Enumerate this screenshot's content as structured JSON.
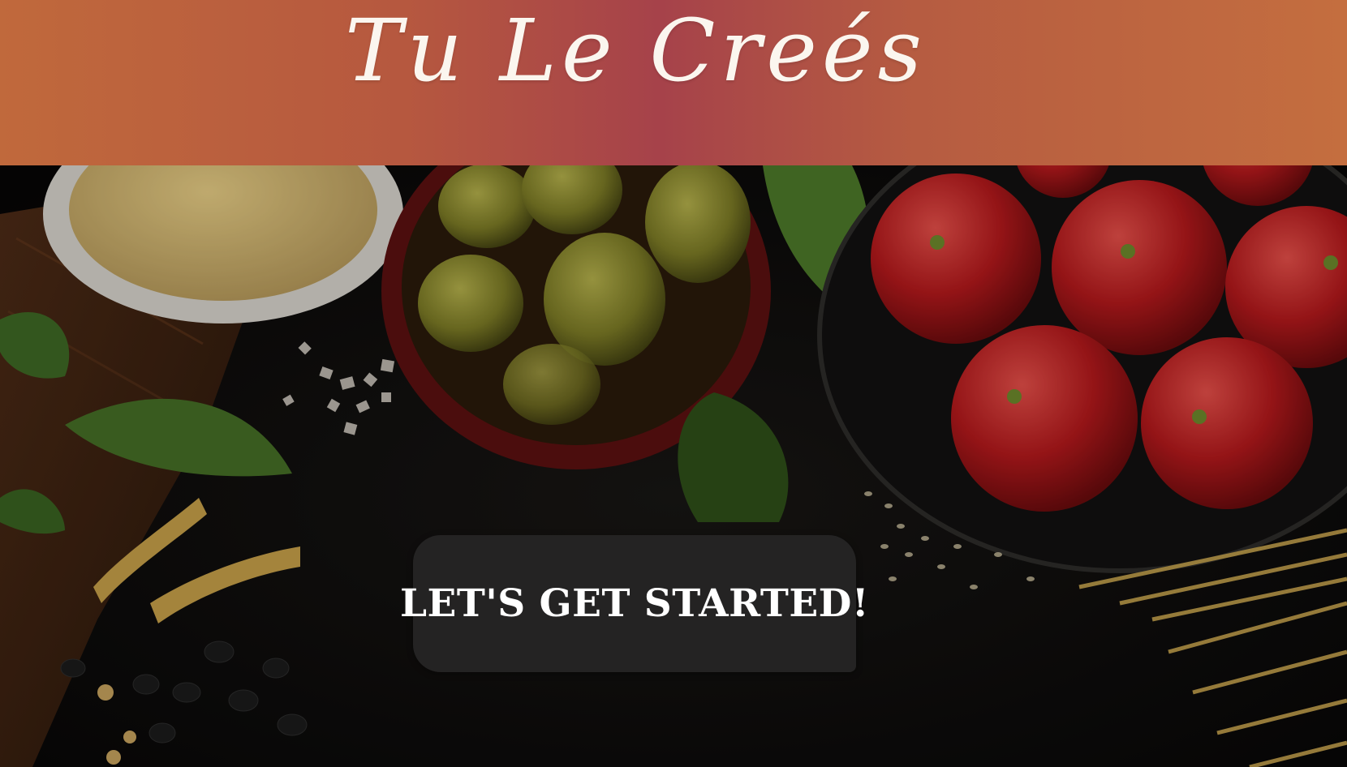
{
  "header": {
    "brand_title": "Tu Le Creés",
    "background_color": "#b0504a"
  },
  "hero": {
    "image_icon": "food-ingredients-photo",
    "cta_label": "LET'S GET STARTED!",
    "cta_background": "#242323"
  }
}
